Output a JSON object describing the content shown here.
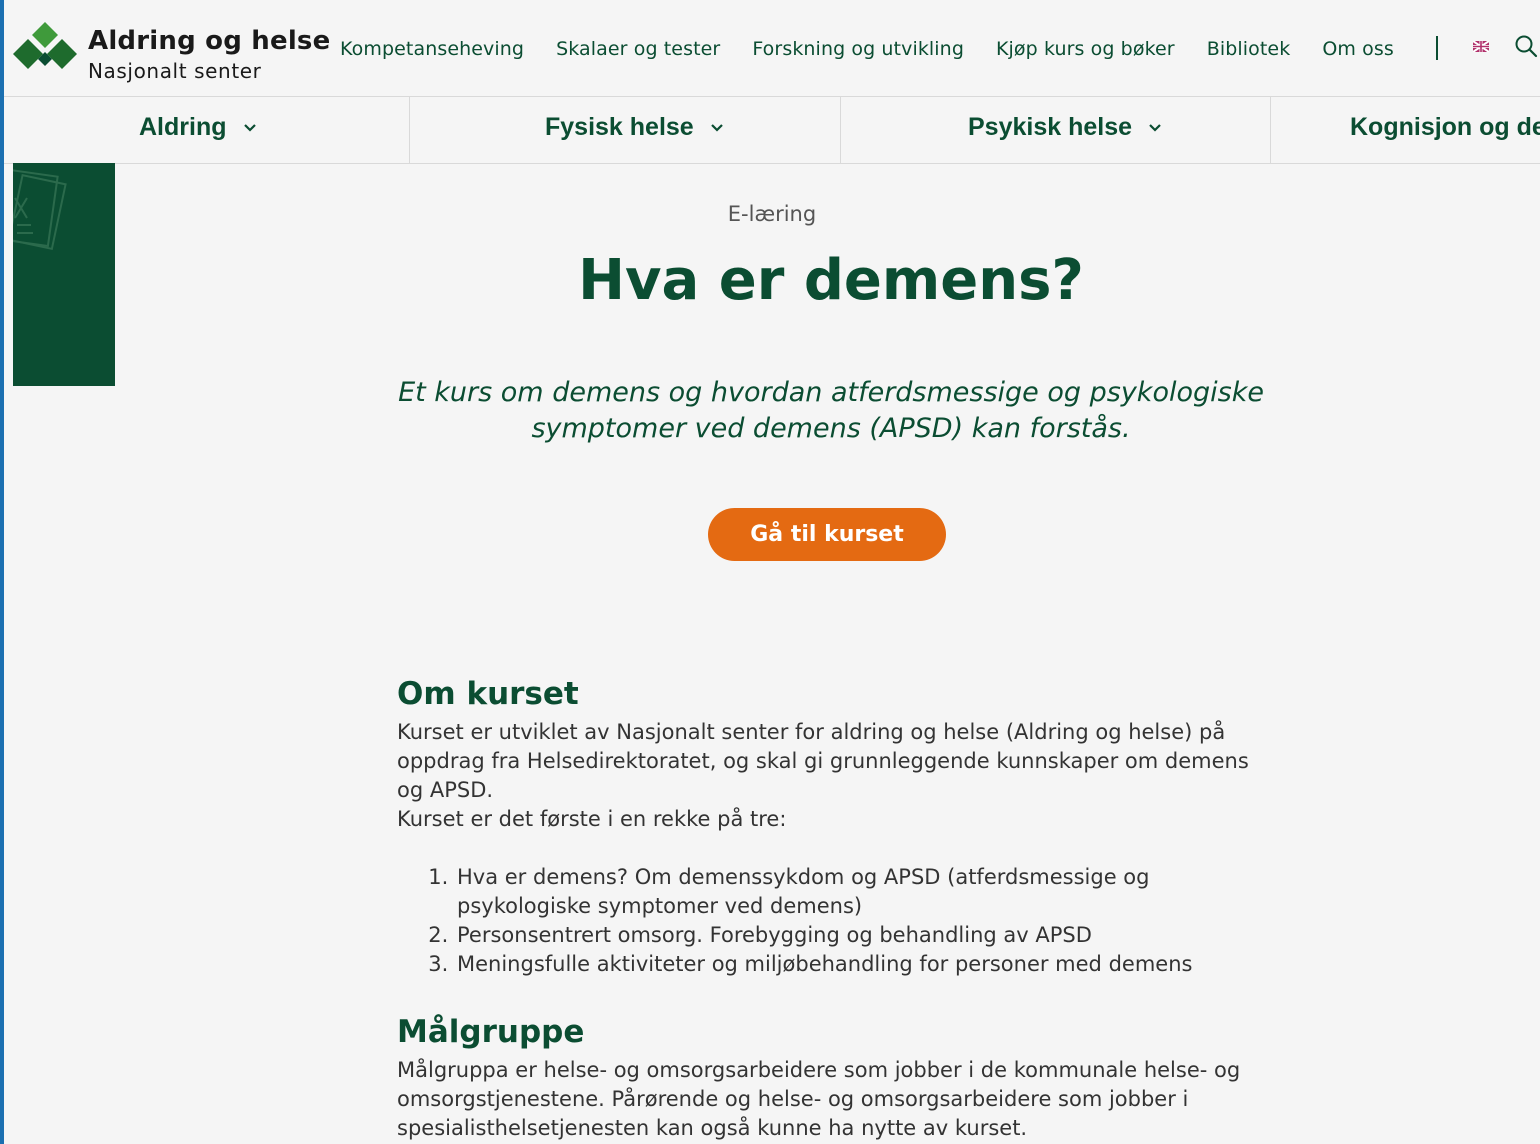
{
  "header": {
    "logo_title": "Aldring og helse",
    "logo_subtitle": "Nasjonalt senter",
    "nav": [
      "Kompetanseheving",
      "Skalaer og tester",
      "Forskning og utvikling",
      "Kjøp kurs og bøker",
      "Bibliotek",
      "Om oss"
    ],
    "divider": "|"
  },
  "categories": [
    "Aldring",
    "Fysisk helse",
    "Psykisk helse",
    "Kognisjon og demens"
  ],
  "main": {
    "eyebrow": "E-læring",
    "title": "Hva er demens?",
    "lead": "Et kurs om demens og hvordan atferdsmessige og psykologiske symptomer ved demens (APSD) kan forstås.",
    "cta_label": "Gå til kurset"
  },
  "about": {
    "heading": "Om kurset",
    "paragraph_1": "Kurset er utviklet av Nasjonalt senter for aldring og helse (Aldring og helse) på oppdrag fra Helsedirektoratet, og skal gi grunnleggende kunnskaper om demens og APSD.",
    "paragraph_2": "Kurset er det første i en rekke på tre:",
    "list": [
      "Hva er demens? Om demenssykdom og APSD (atferdsmessige og psykologiske symptomer ved demens)",
      "Personsentrert omsorg. Forebygging og behandling av APSD",
      "Meningsfulle aktiviteter og miljøbehandling for personer med demens"
    ]
  },
  "audience": {
    "heading": "Målgruppe",
    "paragraph": "Målgruppa er helse- og omsorgsarbeidere som jobber i de kommunale helse- og omsorgstjenestene. Pårørende og helse- og omsorgsarbeidere som jobber i spesialisthelsetjenesten kan også kunne ha nytte av kurset."
  },
  "colors": {
    "brand_green": "#0b4d32",
    "logo_green": "#3f9a3b",
    "cta_orange": "#e46a12",
    "background": "#f5f5f5"
  },
  "icons": {
    "logo": "diamond-logo-icon",
    "search": "search-icon",
    "language": "uk-flag-icon",
    "dropdown": "chevron-down-icon"
  }
}
